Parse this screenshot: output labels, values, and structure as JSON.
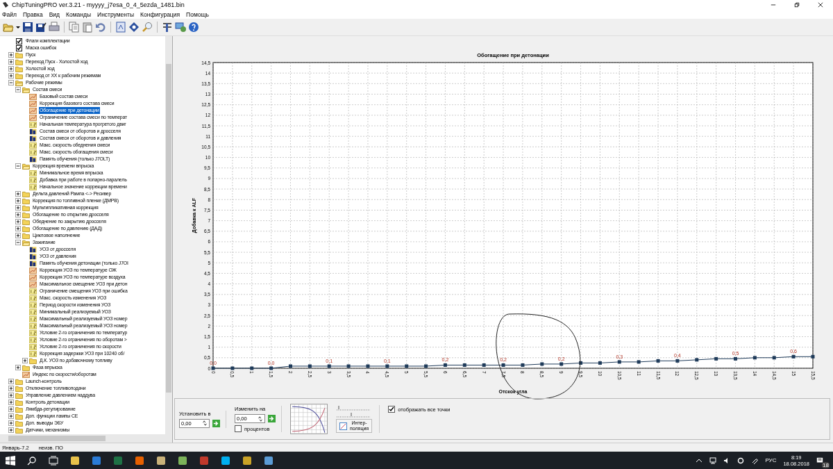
{
  "window": {
    "title": "ChipTuningPRO ver.3.21 - myyyy_j7esa_0_4_5ezda_1481.bin"
  },
  "menu": [
    "Файл",
    "Правка",
    "Вид",
    "Команды",
    "Инструменты",
    "Конфигурация",
    "Помощь"
  ],
  "tree": [
    {
      "label": "Флаги комплектации",
      "kind": "check",
      "selected": false
    },
    {
      "label": "Маска ошибок",
      "kind": "check",
      "selected": false
    },
    {
      "label": "Пуск",
      "kind": "folder",
      "expanded": false,
      "selected": false
    },
    {
      "label": "Переход Пуск - Холостой ход",
      "kind": "folder",
      "expanded": false,
      "selected": false
    },
    {
      "label": "Холостой ход",
      "kind": "folder",
      "expanded": false,
      "selected": false
    },
    {
      "label": "Переход от ХХ к рабочим режимам",
      "kind": "folder",
      "expanded": false,
      "selected": false
    },
    {
      "label": "Рабочие режимы",
      "kind": "folder",
      "expanded": true,
      "selected": false,
      "children": [
        {
          "label": "Состав смеси",
          "kind": "folder",
          "expanded": true,
          "selected": false,
          "children": [
            {
              "label": "Базовый состав смеси",
              "kind": "map",
              "selected": false
            },
            {
              "label": "Коррекция базового состава смеси",
              "kind": "map",
              "selected": false
            },
            {
              "label": "Обогащение при детонации",
              "kind": "map",
              "selected": true
            },
            {
              "label": "Ограничение состава смеси по температ",
              "kind": "map",
              "selected": false
            },
            {
              "label": "Начальная температура прогретого двиг",
              "kind": "const",
              "selected": false
            },
            {
              "label": "Состав смеси от оборотов и дросселя",
              "kind": "table",
              "selected": false
            },
            {
              "label": "Состав смеси от оборотов и давления",
              "kind": "table",
              "selected": false
            },
            {
              "label": "Макс. скорость обеднения смеси",
              "kind": "const",
              "selected": false
            },
            {
              "label": "Макс. скорость обогащения смеси",
              "kind": "const",
              "selected": false
            },
            {
              "label": "Память обучения (только J7OLT)",
              "kind": "table",
              "selected": false
            }
          ]
        },
        {
          "label": "Коррекция времени впрыска",
          "kind": "folder",
          "expanded": true,
          "selected": false,
          "children": [
            {
              "label": "Минимальное время впрыска",
              "kind": "const",
              "selected": false
            },
            {
              "label": "Добавка при работе в попарно-паралель",
              "kind": "const",
              "selected": false
            },
            {
              "label": "Начальное значение коррекции времени",
              "kind": "const",
              "selected": false
            }
          ]
        },
        {
          "label": "Дельта давлений Рампа <-> Ресивер",
          "kind": "folder",
          "expanded": false,
          "selected": false
        },
        {
          "label": "Коррекция по топливной пленке (ДМРВ)",
          "kind": "folder",
          "expanded": false,
          "selected": false
        },
        {
          "label": "Мультипликативная коррекция",
          "kind": "folder",
          "expanded": false,
          "selected": false
        },
        {
          "label": "Обогащение по открытию дросселя",
          "kind": "folder",
          "expanded": false,
          "selected": false
        },
        {
          "label": "Обеднение по закрытию дросселя",
          "kind": "folder",
          "expanded": false,
          "selected": false
        },
        {
          "label": "Обогащение по давлению (ДАД)",
          "kind": "folder",
          "expanded": false,
          "selected": false
        },
        {
          "label": "Цикловое наполнение",
          "kind": "folder",
          "expanded": false,
          "selected": false
        },
        {
          "label": "Зажигание",
          "kind": "folder",
          "expanded": true,
          "selected": false,
          "children": [
            {
              "label": "УОЗ от дросселя",
              "kind": "table",
              "selected": false
            },
            {
              "label": "УОЗ от давления",
              "kind": "table",
              "selected": false
            },
            {
              "label": "Память обучения детонации (только J7OI",
              "kind": "table",
              "selected": false
            },
            {
              "label": "Коррекция УОЗ по температуре ОЖ",
              "kind": "map",
              "selected": false
            },
            {
              "label": "Коррекция УОЗ по температуре воздуха",
              "kind": "map",
              "selected": false
            },
            {
              "label": "Максимальное смещение УОЗ при детон",
              "kind": "map",
              "selected": false
            },
            {
              "label": "Ограничение смещения УОЗ при ошибка",
              "kind": "const",
              "selected": false
            },
            {
              "label": "Макс. скорость изменения УОЗ",
              "kind": "const",
              "selected": false
            },
            {
              "label": "Период скорости изменения УОЗ",
              "kind": "const",
              "selected": false
            },
            {
              "label": "Минимальный реализуемый УОЗ",
              "kind": "const",
              "selected": false
            },
            {
              "label": "Максимальный реализуемый УОЗ номер",
              "kind": "const",
              "selected": false
            },
            {
              "label": "Максимальный реализуемый УОЗ номер",
              "kind": "const",
              "selected": false
            },
            {
              "label": "Условие 2-го ограничения по температур",
              "kind": "const",
              "selected": false
            },
            {
              "label": "Условие 2-го ограничения по оборотам >",
              "kind": "const",
              "selected": false
            },
            {
              "label": "Условие 2-го ограничения по скорости",
              "kind": "const",
              "selected": false
            },
            {
              "label": "Коррекция задержки УОЗ при 10240 об/",
              "kind": "const",
              "selected": false
            },
            {
              "label": "Д.К. УОЗ по добавочному топливу",
              "kind": "folder",
              "expanded": false,
              "selected": false
            }
          ]
        },
        {
          "label": "Фаза впрыска",
          "kind": "folder",
          "expanded": false,
          "selected": false
        },
        {
          "label": "Индекс по скорости/оборотам",
          "kind": "map",
          "selected": false
        }
      ]
    },
    {
      "label": "Launch-контроль",
      "kind": "folder",
      "expanded": false,
      "selected": false
    },
    {
      "label": "Отключение топливоподачи",
      "kind": "folder",
      "expanded": false,
      "selected": false
    },
    {
      "label": "Управление давлением наддува",
      "kind": "folder",
      "expanded": false,
      "selected": false
    },
    {
      "label": "Контроль детонации",
      "kind": "folder",
      "expanded": false,
      "selected": false
    },
    {
      "label": "Лямбда-регулирование",
      "kind": "folder",
      "expanded": false,
      "selected": false
    },
    {
      "label": "Доп. функции лампы CE",
      "kind": "folder",
      "expanded": false,
      "selected": false
    },
    {
      "label": "Доп. выводы ЭБУ",
      "kind": "folder",
      "expanded": false,
      "selected": false
    },
    {
      "label": "Датчики, механизмы",
      "kind": "folder",
      "expanded": false,
      "selected": false
    }
  ],
  "chart": {
    "chart_data": {
      "type": "line",
      "title": "Обогащение при детонации",
      "xlabel": "Отскок угла",
      "ylabel": "Добавка к ALF",
      "x": [
        0,
        0.5,
        1,
        1.5,
        2,
        2.5,
        3,
        3.5,
        4,
        4.5,
        5,
        5.5,
        6,
        6.5,
        7,
        7.5,
        8,
        8.5,
        9,
        9.5,
        10,
        10.5,
        11,
        11.5,
        12,
        12.5,
        13,
        13.5,
        14,
        14.5,
        15,
        15.5
      ],
      "grid": true,
      "series": [
        {
          "color": "#1f3b5a",
          "marker": "square",
          "values": [
            0,
            0,
            0,
            0,
            0.1,
            0.1,
            0.1,
            0.1,
            0.1,
            0.1,
            0.1,
            0.1,
            0.15,
            0.15,
            0.15,
            0.15,
            0.15,
            0.2,
            0.2,
            0.25,
            0.25,
            0.3,
            0.3,
            0.35,
            0.35,
            0.4,
            0.45,
            0.45,
            0.5,
            0.5,
            0.55,
            0.55
          ]
        }
      ],
      "xlim": [
        0,
        15.5
      ],
      "ylim": [
        0,
        14.5
      ],
      "xticks": [
        0,
        {
          "value": 0.5,
          "label": "0,5"
        },
        1,
        {
          "value": 1.5,
          "label": "1,5"
        },
        2,
        {
          "value": 2.5,
          "label": "2,5"
        },
        3,
        {
          "value": 3.5,
          "label": "3,5"
        },
        4,
        {
          "value": 4.5,
          "label": "4,5"
        },
        5,
        {
          "value": 5.5,
          "label": "5,5"
        },
        6,
        {
          "value": 6.5,
          "label": "6,5"
        },
        7,
        {
          "value": 7.5,
          "label": "7,5"
        },
        8,
        {
          "value": 8.5,
          "label": "8,5"
        },
        9,
        {
          "value": 9.5,
          "label": "9,5"
        },
        10,
        {
          "value": 10.5,
          "label": "10,5"
        },
        11,
        {
          "value": 11.5,
          "label": "11,5"
        },
        12,
        {
          "value": 12.5,
          "label": "12,5"
        },
        13,
        {
          "value": 13.5,
          "label": "13,5"
        },
        14,
        {
          "value": 14.5,
          "label": "14,5"
        },
        15,
        {
          "value": 15.5,
          "label": "15,5"
        }
      ],
      "yticks": [
        0,
        {
          "value": 0.5,
          "label": "0,5"
        },
        1,
        {
          "value": 1.5,
          "label": "1,5"
        },
        2,
        {
          "value": 2.5,
          "label": "2,5"
        },
        3,
        {
          "value": 3.5,
          "label": "3,5"
        },
        4,
        {
          "value": 4.5,
          "label": "4,5"
        },
        5,
        {
          "value": 5.5,
          "label": "5,5"
        },
        6,
        {
          "value": 6.5,
          "label": "6,5"
        },
        7,
        {
          "value": 7.5,
          "label": "7,5"
        },
        8,
        {
          "value": 8.5,
          "label": "8,5"
        },
        9,
        {
          "value": 9.5,
          "label": "9,5"
        },
        10,
        {
          "value": 10.5,
          "label": "10,5"
        },
        11,
        {
          "value": 11.5,
          "label": "11,5"
        },
        12,
        {
          "value": 12.5,
          "label": "12,5"
        },
        13,
        {
          "value": 13.5,
          "label": "13,5"
        },
        14,
        {
          "value": 14.5,
          "label": "14,5"
        }
      ],
      "annotations": [
        {
          "x": 0,
          "y": 0,
          "text": "0,0"
        },
        {
          "x": 1.5,
          "y": 0,
          "text": "0,0"
        },
        {
          "x": 3,
          "y": 0.1,
          "text": "0,1"
        },
        {
          "x": 4.5,
          "y": 0.1,
          "text": "0,1"
        },
        {
          "x": 6,
          "y": 0.15,
          "text": "0,2"
        },
        {
          "x": 7.5,
          "y": 0.15,
          "text": "0,2"
        },
        {
          "x": 9,
          "y": 0.2,
          "text": "0,2"
        },
        {
          "x": 10.5,
          "y": 0.3,
          "text": "0,3"
        },
        {
          "x": 12,
          "y": 0.35,
          "text": "0,4"
        },
        {
          "x": 13.5,
          "y": 0.45,
          "text": "0,5"
        },
        {
          "x": 15,
          "y": 0.55,
          "text": "0,6"
        }
      ]
    }
  },
  "controls": {
    "set_label": "Установить в",
    "set_value": "0,00",
    "change_label": "Изменить на",
    "change_value": "0,00",
    "percent": {
      "label": "процентов",
      "checked": false
    },
    "interp_button": "Интер-\nполяция",
    "show_all": {
      "label": "отображать все точки",
      "checked": true
    }
  },
  "status_bar": [
    "Январь-7.2",
    "неизв. ПО"
  ],
  "taskbar": {
    "lang": "РУС",
    "time": "8:19",
    "date": "18.08.2018",
    "notifications": "18"
  }
}
